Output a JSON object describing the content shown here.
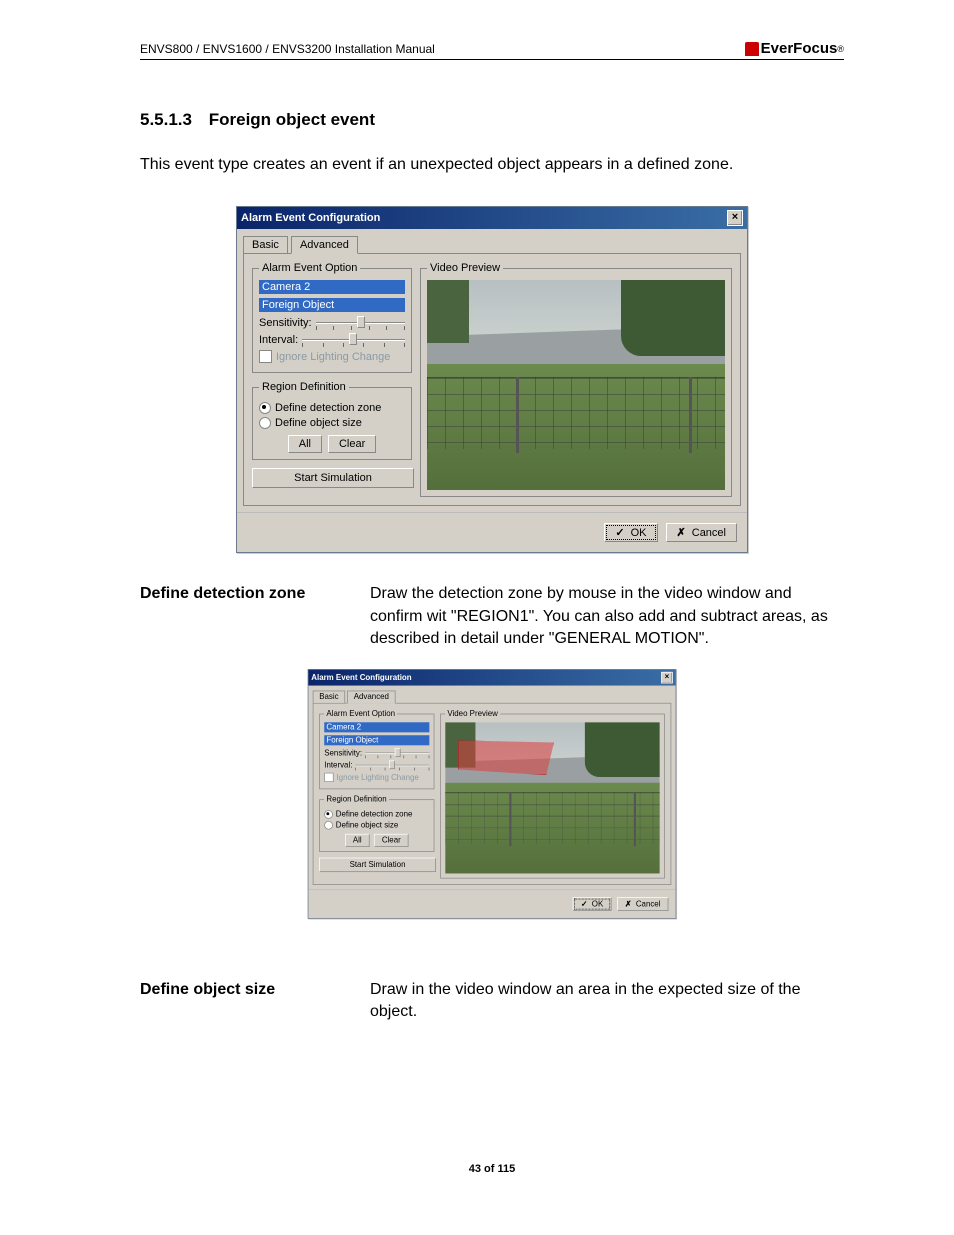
{
  "header": {
    "doc_title": "ENVS800 / ENVS1600 / ENVS3200 Installation Manual",
    "brand": "EverFocus",
    "brand_mark": "®"
  },
  "section": {
    "number": "5.5.1.3",
    "title": "Foreign object event",
    "intro": "This event type creates an event if an unexpected object appears in a defined zone."
  },
  "dialog": {
    "title": "Alarm Event Configuration",
    "tabs": {
      "basic": "Basic",
      "advanced": "Advanced"
    },
    "alarm_legend": "Alarm Event Option",
    "camera": "Camera 2",
    "type": "Foreign Object",
    "sensitivity_label": "Sensitivity:",
    "interval_label": "Interval:",
    "ignore_label": "Ignore Lighting Change",
    "region_legend": "Region Definition",
    "region_opts": {
      "detection": "Define detection zone",
      "object": "Define object size"
    },
    "btn_all": "All",
    "btn_clear": "Clear",
    "btn_start": "Start Simulation",
    "preview_legend": "Video Preview",
    "btn_ok": "OK",
    "btn_cancel": "Cancel",
    "close_glyph": "×",
    "tick_glyph": "✓",
    "cross_glyph": "✗"
  },
  "defs": {
    "detection_term": "Define detection zone",
    "detection_desc": "Draw the detection zone by mouse in the video window and confirm wit \"REGION1\". You can also add and subtract areas, as described in detail under \"GENERAL MOTION\".",
    "object_term": "Define object size",
    "object_desc": "Draw in the video window an area in the expected size of the object."
  },
  "footer": {
    "page": "43 of 115"
  }
}
